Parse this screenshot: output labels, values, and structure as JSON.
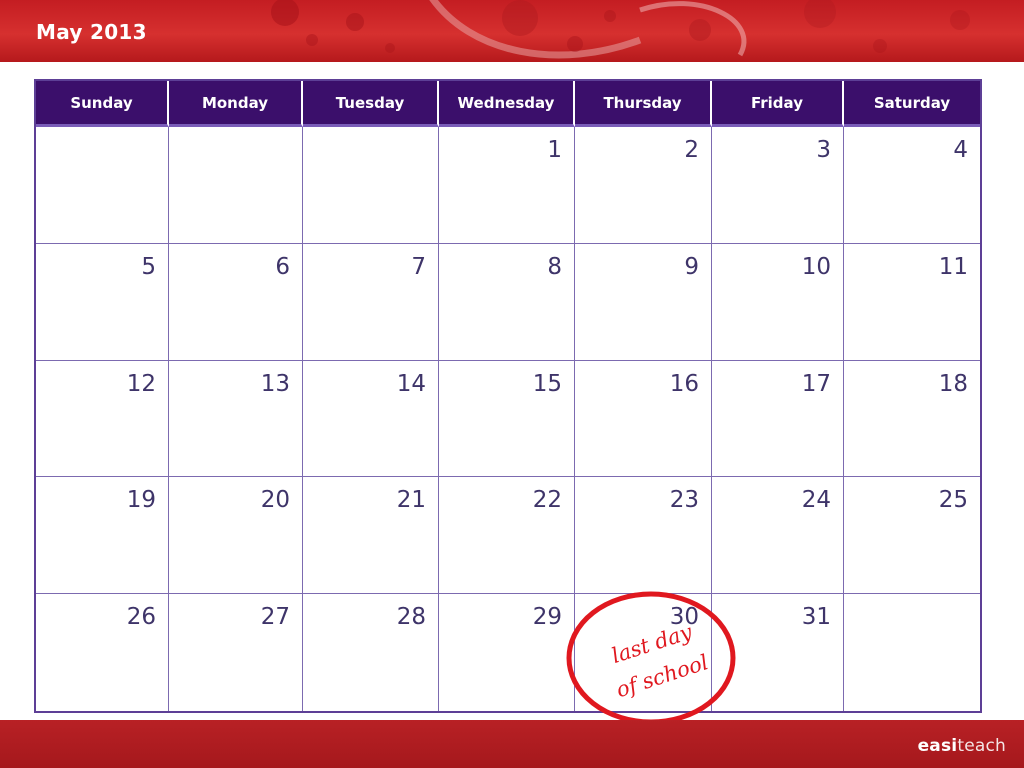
{
  "header": {
    "title": "May 2013"
  },
  "calendar": {
    "days": [
      "Sunday",
      "Monday",
      "Tuesday",
      "Wednesday",
      "Thursday",
      "Friday",
      "Saturday"
    ],
    "weeks": [
      [
        "",
        "",
        "",
        "1",
        "2",
        "3",
        "4"
      ],
      [
        "5",
        "6",
        "7",
        "8",
        "9",
        "10",
        "11"
      ],
      [
        "12",
        "13",
        "14",
        "15",
        "16",
        "17",
        "18"
      ],
      [
        "19",
        "20",
        "21",
        "22",
        "23",
        "24",
        "25"
      ],
      [
        "26",
        "27",
        "28",
        "29",
        "30",
        "31",
        ""
      ]
    ]
  },
  "annotation": {
    "text": "last day\nof school",
    "date": "30",
    "color": "#e0181f"
  },
  "footer": {
    "brand_bold": "easi",
    "brand_rest": "teach"
  },
  "colors": {
    "header_red": "#c41d22",
    "day_header_purple": "#3b0f6b",
    "grid_line": "#7c6ab0",
    "date_text": "#3e3469"
  }
}
